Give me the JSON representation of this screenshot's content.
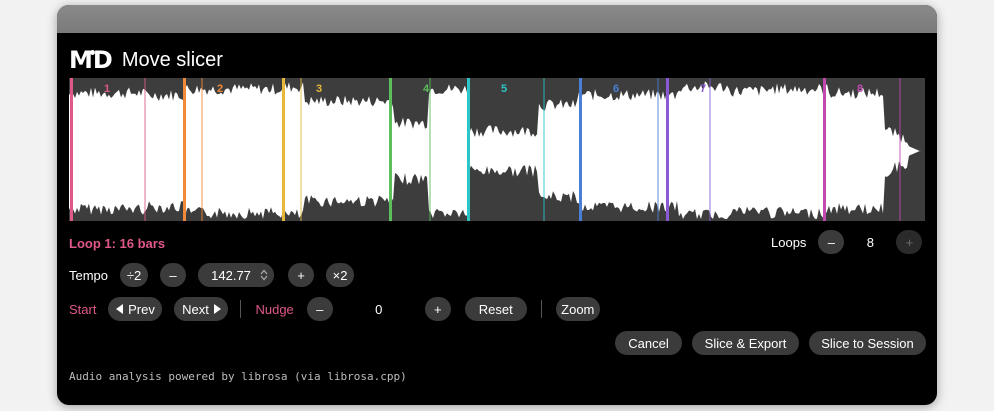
{
  "app": {
    "logo": "MD",
    "title": "Move slicer"
  },
  "waveform": {
    "slice_markers": [
      {
        "label": "1",
        "color": "#e0588a"
      },
      {
        "label": "2",
        "color": "#f08a3a"
      },
      {
        "label": "3",
        "color": "#e6b83a"
      },
      {
        "label": "4",
        "color": "#5cbf5c"
      },
      {
        "label": "5",
        "color": "#2cc6c6"
      },
      {
        "label": "6",
        "color": "#4a7fd6"
      },
      {
        "label": "7",
        "color": "#8a5ad6"
      },
      {
        "label": "8",
        "color": "#c04ab0"
      }
    ]
  },
  "loop": {
    "label": "Loop 1: 16 bars"
  },
  "loops": {
    "label": "Loops",
    "minus": "–",
    "value": "8",
    "plus": "+"
  },
  "tempo": {
    "label": "Tempo",
    "half": "÷2",
    "minus": "–",
    "value": "142.77",
    "plus": "+",
    "double": "×2"
  },
  "start": {
    "label": "Start",
    "prev": "Prev",
    "next": "Next"
  },
  "nudge": {
    "label": "Nudge",
    "minus": "–",
    "value": "0",
    "plus": "+",
    "reset": "Reset"
  },
  "zoom": {
    "label": "Zoom"
  },
  "actions": {
    "cancel": "Cancel",
    "export": "Slice & Export",
    "session": "Slice to Session"
  },
  "footer": {
    "text": "Audio analysis powered by librosa (via librosa.cpp)"
  },
  "colors": {
    "accent": "#e0588a",
    "background": "#000000",
    "button": "#3b3b3b"
  }
}
